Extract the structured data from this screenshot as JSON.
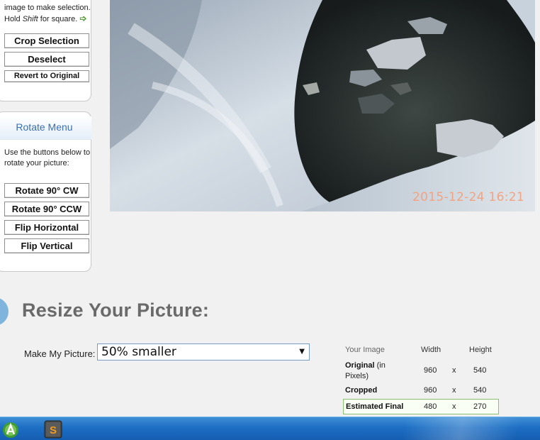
{
  "crop_panel": {
    "instructions_line1": "image to make selection.",
    "instructions_line2_pre": "Hold ",
    "instructions_line2_key": "Shift",
    "instructions_line2_post": " for square.",
    "crop_selection": "Crop Selection",
    "deselect": "Deselect",
    "revert": "Revert to Original"
  },
  "rotate_panel": {
    "title": "Rotate Menu",
    "instructions": "Use the buttons below to rotate your picture:",
    "rotate_cw": "Rotate 90° CW",
    "rotate_ccw": "Rotate 90° CCW",
    "flip_horizontal": "Flip Horizontal",
    "flip_vertical": "Flip Vertical"
  },
  "photo": {
    "timestamp": "2015-12-24 16:21"
  },
  "resize": {
    "title": "Resize Your Picture:",
    "make_label": "Make My Picture:",
    "selected_option": "50% smaller"
  },
  "info_table": {
    "headers": {
      "image": "Your Image",
      "width": "Width",
      "height": "Height"
    },
    "rows": [
      {
        "label": "Original",
        "label_suffix": " (in",
        "label_line2": "Pixels)",
        "width": "960",
        "x": "x",
        "height": "540"
      },
      {
        "label": "Cropped",
        "width": "960",
        "x": "x",
        "height": "540"
      },
      {
        "label": "Estimated Final",
        "width": "480",
        "x": "x",
        "height": "270"
      }
    ]
  },
  "taskbar": {
    "icons": [
      "android-studio-icon",
      "sublime-text-icon"
    ],
    "accent": "#1c6ec4"
  }
}
